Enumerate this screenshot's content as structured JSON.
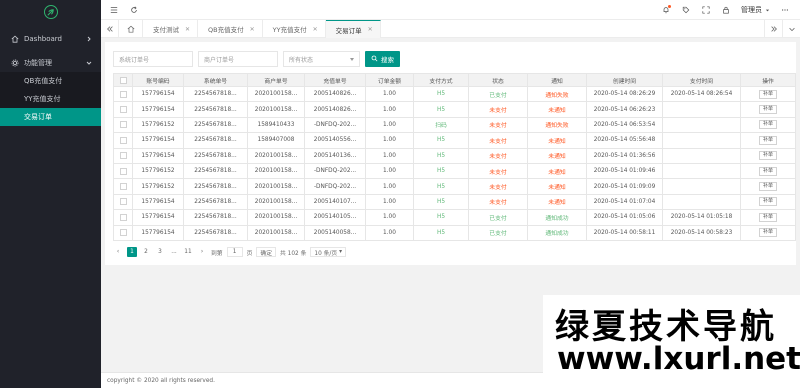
{
  "sidebar": {
    "dashboard": "Dashboard",
    "group": "功能管理",
    "items": [
      {
        "label": "QB充值支付"
      },
      {
        "label": "YY充值支付"
      },
      {
        "label": "交易订单"
      }
    ]
  },
  "header": {
    "user": "管理员"
  },
  "tabs": [
    {
      "label": "支付测试"
    },
    {
      "label": "QB充值支付"
    },
    {
      "label": "YY充值支付"
    },
    {
      "label": "交易订单"
    }
  ],
  "filters": {
    "system_order_placeholder": "系统订单号",
    "merchant_order_placeholder": "商户订单号",
    "status_select": "所有状态",
    "search_label": "搜索"
  },
  "table": {
    "headers": [
      "",
      "账号编码",
      "系统单号",
      "商户单号",
      "充值单号",
      "订单金额",
      "支付方式",
      "状态",
      "通知",
      "创建时间",
      "支付时间",
      "操作"
    ],
    "rows": [
      [
        "157796154",
        "22545678​18...",
        "2020100158...",
        "2005140826...",
        "1.00",
        "H5",
        "已支付",
        "通知失败",
        "2020-05-14 08:26:29",
        "2020-05-14 08:26:54",
        "补单"
      ],
      [
        "157796154",
        "22545678​18...",
        "2020100158...",
        "2005140826...",
        "1.00",
        "H5",
        "未支付",
        "未通知",
        "2020-05-14 06:26:23",
        "",
        "补单"
      ],
      [
        "157796152",
        "22545678​18...",
        "1589410433",
        "-DNFDQ-202...",
        "1.00",
        "扫码",
        "未支付",
        "通知失败",
        "2020-05-14 06:53:54",
        "",
        "补单"
      ],
      [
        "157796154",
        "22545678​18...",
        "1589407008",
        "2005140556...",
        "1.00",
        "H5",
        "未支付",
        "未通知",
        "2020-05-14 05:56:48",
        "",
        "补单"
      ],
      [
        "157796154",
        "22545678​18...",
        "2020100158...",
        "2005140136...",
        "1.00",
        "H5",
        "未支付",
        "未通知",
        "2020-05-14 01:36:56",
        "",
        "补单"
      ],
      [
        "157796152",
        "22545678​18...",
        "2020100158...",
        "-DNFDQ-202...",
        "1.00",
        "H5",
        "未支付",
        "未通知",
        "2020-05-14 01:09:46",
        "",
        "补单"
      ],
      [
        "157796152",
        "22545678​18...",
        "2020100158...",
        "-DNFDQ-202...",
        "1.00",
        "H5",
        "未支付",
        "未通知",
        "2020-05-14 01:09:09",
        "",
        "补单"
      ],
      [
        "157796154",
        "22545678​18...",
        "2020100158...",
        "2005140107...",
        "1.00",
        "H5",
        "未支付",
        "未通知",
        "2020-05-14 01:07:04",
        "",
        "补单"
      ],
      [
        "157796154",
        "22545678​18...",
        "2020100158...",
        "2005140105...",
        "1.00",
        "H5",
        "已支付",
        "通知成功",
        "2020-05-14 01:05:06",
        "2020-05-14 01:05:18",
        "补单"
      ],
      [
        "157796154",
        "22545678​18...",
        "2020100158...",
        "2005140058...",
        "1.00",
        "H5",
        "已支付",
        "通知成功",
        "2020-05-14 00:58:11",
        "2020-05-14 00:58:23",
        "补单"
      ]
    ]
  },
  "pagination": {
    "pages": [
      "1",
      "2",
      "3",
      "...",
      "11"
    ],
    "goto_label": "到第",
    "goto_value": "1",
    "page_unit": "页",
    "confirm": "确定",
    "total": "共 102 条",
    "per_page": "10 条/页"
  },
  "footer": "copyright © 2020 all rights reserved.",
  "watermark": {
    "line1": "绿夏技术导航",
    "line2": "www.lxurl.net"
  },
  "colors": {
    "sidebar_bg": "#20222a",
    "accent": "#009688",
    "success": "#5FB878",
    "danger": "#FF5722"
  }
}
